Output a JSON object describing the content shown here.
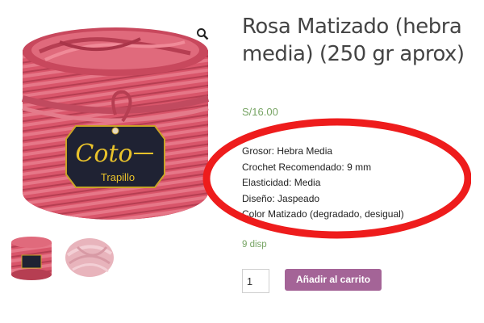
{
  "product": {
    "title": "Rosa Matizado (hebra media) (250 gr aprox)",
    "price": "S/16.00",
    "details": [
      "Grosor: Hebra Media",
      "Crochet Recomendado: 9 mm",
      "Elasticidad: Media",
      "Diseño: Jaspeado",
      "Color Matizado (degradado, desigual)"
    ],
    "stock_text": "9 disp"
  },
  "gallery": {
    "brand_logo_text": "Coto",
    "brand_logo_subtext": "Trapillo",
    "zoom_icon": "magnifier-icon"
  },
  "cart": {
    "quantity": "1",
    "add_to_cart_label": "Añadir al carrito"
  },
  "colors": {
    "yarn_pink": "#d9556a",
    "yarn_light_pink": "#e8b4bc",
    "price_green": "#77a464",
    "button_purple": "#a46497",
    "annotation_red": "#ee1c1c",
    "label_navy": "#1f2233",
    "label_gold": "#e9c22b"
  }
}
